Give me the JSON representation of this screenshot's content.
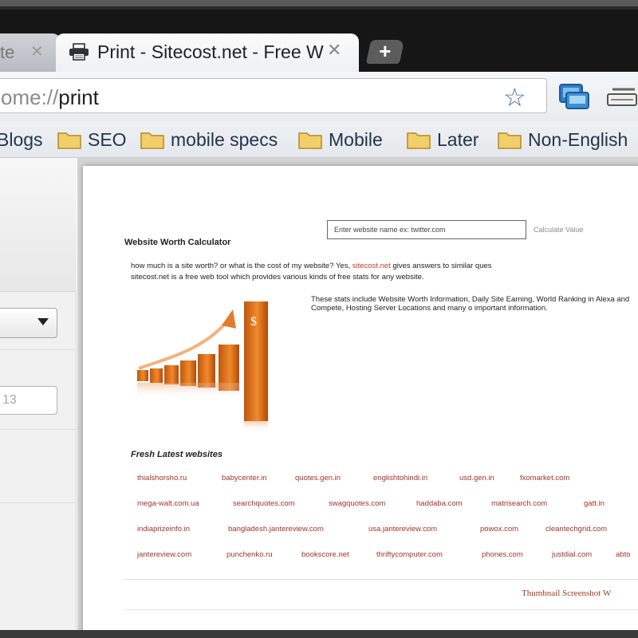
{
  "browser": {
    "tabs": [
      {
        "title": "te",
        "active": false
      },
      {
        "title": "Print - Sitecost.net - Free W",
        "active": true
      }
    ],
    "omnibox": {
      "scheme": "ome://",
      "path": "print"
    },
    "bookmarks": [
      "Blogs",
      "SEO",
      "mobile specs",
      "Mobile",
      "Later",
      "Non-English"
    ],
    "icons": [
      "print-favicon",
      "close-icon",
      "new-tab-icon",
      "star-icon",
      "print-page-icon",
      "wrench-icon",
      "folder-icon",
      "dropdown-arrow-icon"
    ],
    "colors": {
      "accent": "#3d6fa8",
      "bookmark_text": "#23344f",
      "link": "#a0342a"
    }
  },
  "print_settings": {
    "destination_value": "",
    "pages_placeholder": "13"
  },
  "page": {
    "site_input_placeholder": "Enter website name ex: twitter.com",
    "calculate_link": "Calculate Value",
    "heading": "Website Worth Calculator",
    "intro_line1_before": "how much is a site worth? or what is the cost of my website? Yes, ",
    "intro_brand": "sitecost.net",
    "intro_line1_after": " gives answers to similar ques",
    "intro_line2": "sitecost.net is a free web tool which provides various kinds of free stats for any website.",
    "stats_text": "These stats include Website Worth Information, Daily Site Earning, World Ranking in Alexa and Compete, Hosting Server Locations and many o important information.",
    "fresh_heading": "Fresh Latest websites",
    "links": [
      [
        "thialshorsho.ru",
        "babycenter.in",
        "quotes.gen.in",
        "englishtohindi.in",
        "usd.gen.in",
        "fxomarket.com"
      ],
      [
        "mega-walt.com.ua",
        "searchquotes.com",
        "swagquotes.com",
        "haddaba.com",
        "matrisearch.com",
        "gatt.in"
      ],
      [
        "indiaprizeinfo.in",
        "bangladesh.jantereview.com",
        "usa.jantereview.com",
        "powox.com",
        "cleantechgrid.com"
      ],
      [
        "jantereview.com",
        "punchenko.ru",
        "bookscore.net",
        "thriftycomputer.com",
        "phones.com",
        "justdial.com",
        "abto"
      ]
    ],
    "thumbnail_label": "Thumbnail Screenshot W"
  }
}
